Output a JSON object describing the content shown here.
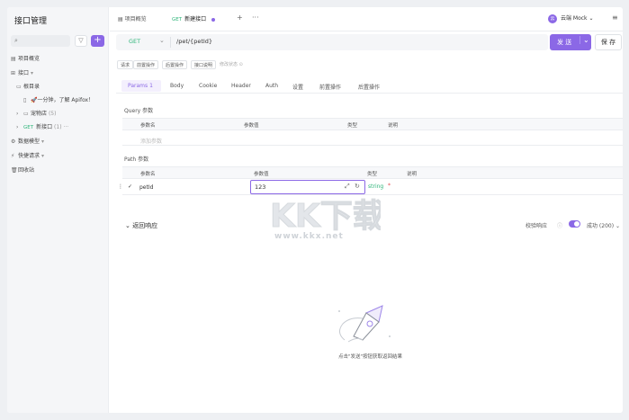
{
  "sidebar": {
    "title": "接口管理",
    "add_label": "+",
    "items": [
      {
        "icon": "overview-icon",
        "label": "项目概览"
      },
      {
        "icon": "interface-icon",
        "label": "接口"
      },
      {
        "icon": "folder-icon",
        "label": "根目录"
      },
      {
        "icon": "doc-icon",
        "label": "🚀一分钟，了解 Apifox！"
      },
      {
        "icon": "folder-icon",
        "label": "宠物店",
        "count": "(5)"
      },
      {
        "method": "GET",
        "label": "新接口",
        "count": "(1)"
      },
      {
        "icon": "model-icon",
        "label": "数据模型"
      },
      {
        "icon": "request-icon",
        "label": "快捷请求"
      },
      {
        "icon": "trash-icon",
        "label": "回收站"
      }
    ]
  },
  "tabs": [
    {
      "label": "项目概览"
    },
    {
      "method": "GET",
      "label": "新建接口"
    }
  ],
  "env": {
    "avatar": "云",
    "label": "云端 Mock"
  },
  "request": {
    "method": "GET",
    "path": "/pet/{petId}",
    "send_label": "发 送",
    "save_label": "保 存"
  },
  "actions": [
    "请求",
    "前置操作",
    "后置操作",
    "接口说明"
  ],
  "actions_muted": "修改状态 ⊙",
  "param_tabs": [
    {
      "label": "Params",
      "count": "1"
    },
    {
      "label": "Body"
    },
    {
      "label": "Cookie"
    },
    {
      "label": "Header"
    },
    {
      "label": "Auth"
    },
    {
      "label": "设置"
    },
    {
      "label": "前置操作"
    },
    {
      "label": "后置操作"
    }
  ],
  "query": {
    "label": "Query 参数",
    "headers": [
      "参数名",
      "参数值",
      "类型",
      "说明"
    ],
    "placeholder": "添加参数"
  },
  "path_params": {
    "label": "Path 参数",
    "headers": [
      "参数名",
      "参数值",
      "类型",
      "说明"
    ],
    "row": {
      "name": "petId",
      "value": "123",
      "type": "string",
      "required": "*"
    }
  },
  "response": {
    "title": "返回响应",
    "validate_label": "校验响应",
    "status_label": "成功 (200)",
    "empty_text": "点击\"发送\"按钮获取返回结果"
  },
  "watermark": {
    "brand": "KK下载",
    "url": "www.kkx.net"
  }
}
